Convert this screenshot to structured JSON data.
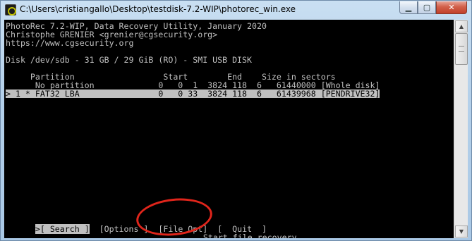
{
  "window": {
    "title": "C:\\Users\\cristiangallo\\Desktop\\testdisk-7.2-WIP\\photorec_win.exe",
    "minimize_glyph": "▁",
    "maximize_glyph": "▢",
    "close_glyph": "✕"
  },
  "console": {
    "header": [
      "PhotoRec 7.2-WIP, Data Recovery Utility, January 2020",
      "Christophe GRENIER <grenier@cgsecurity.org>",
      "https://www.cgsecurity.org"
    ],
    "disk_line": "Disk /dev/sdb - 31 GB / 29 GiB (RO) - SMI USB DISK",
    "table_header": "     Partition                  Start        End    Size in sectors",
    "rows": [
      {
        "text": "      No partition             0   0  1  3824 118  6   61440000 [Whole disk]",
        "selected": false
      },
      {
        "text": "> 1 * FAT32 LBA                0   0 33  3824 118  6   61439968 [PENDRIVE32]",
        "selected": true
      }
    ],
    "menu": {
      "search": ">[ Search ]",
      "options": "[Options ]",
      "file_opt": "[File Opt]",
      "quit": "[  Quit  ]"
    },
    "status": "Start file recovery",
    "cursor": "_"
  },
  "scrollbar": {
    "up_glyph": "▲",
    "down_glyph": "▼"
  },
  "colors": {
    "console_bg": "#000000",
    "console_fg": "#c0c0c0",
    "highlight_bg": "#c0c0c0",
    "annotation": "#e0251b"
  }
}
